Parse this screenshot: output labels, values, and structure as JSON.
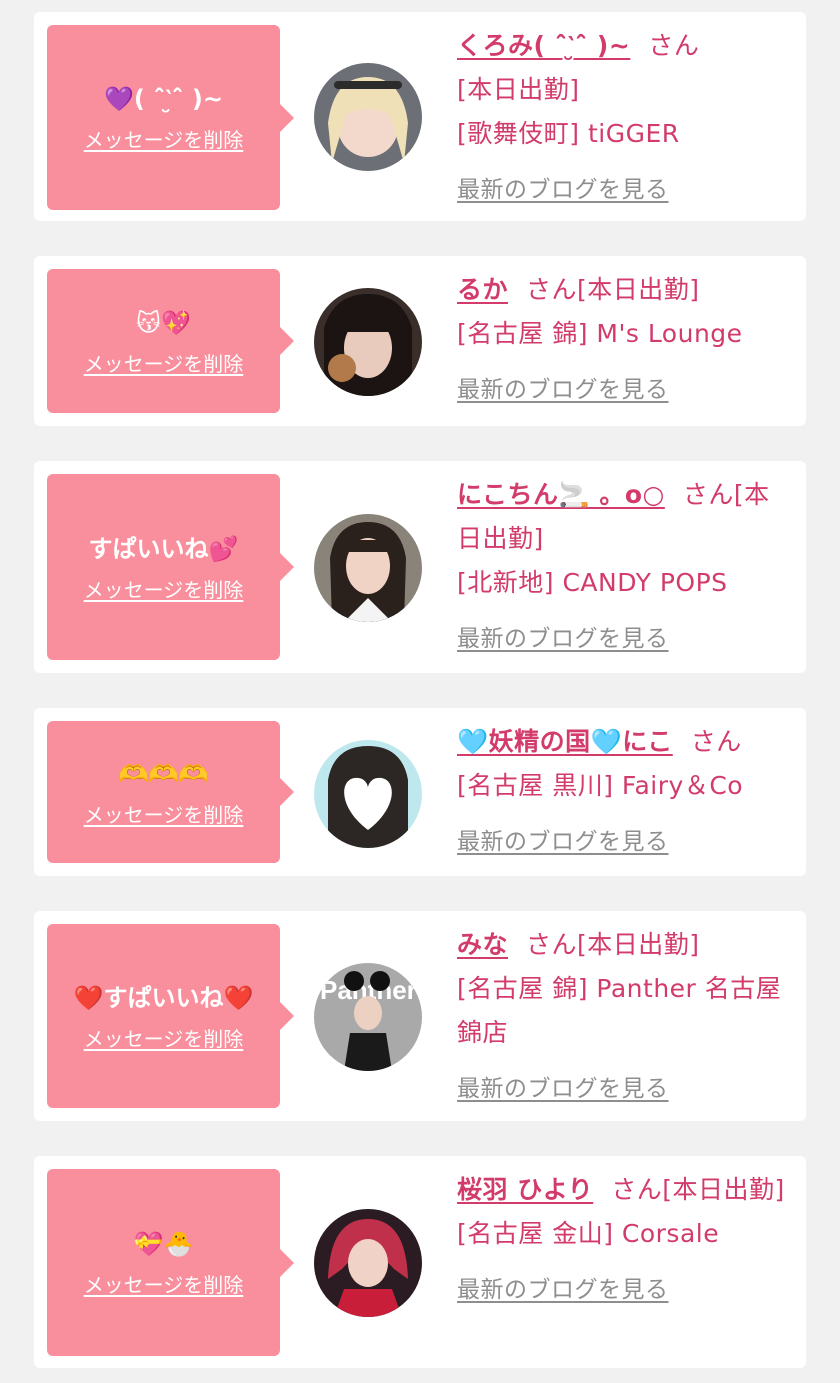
{
  "cards": [
    {
      "message": "💜( ˆ̑‵̮ˆ̑ )~",
      "delete_label": "メッセージを削除",
      "name": "くろみ( ˆ̑‵̮ˆ̑ )~",
      "san": "さん",
      "status": "[本日出勤]",
      "shop": "[歌舞伎町] tiGGER",
      "blog_label": "最新のブログを見る"
    },
    {
      "message": "😽💖",
      "delete_label": "メッセージを削除",
      "name": "るか",
      "san": "さん",
      "status": "[本日出勤]",
      "shop": "[名古屋 錦] M's Lounge",
      "blog_label": "最新のブログを見る"
    },
    {
      "message": "すぱいいね💕",
      "delete_label": "メッセージを削除",
      "name": "にこちん🚬 。o○",
      "san": "さん",
      "status": "[本日出勤]",
      "shop": "[北新地] CANDY POPS",
      "blog_label": "最新のブログを見る"
    },
    {
      "message": "🫶🫶🫶",
      "delete_label": "メッセージを削除",
      "name": "🩵妖精の国🩵にこ",
      "san": "さん",
      "status": "",
      "shop": "[名古屋 黒川] Fairy＆Co",
      "blog_label": "最新のブログを見る"
    },
    {
      "message": "❤️すぱいいね❤️",
      "delete_label": "メッセージを削除",
      "name": "みな",
      "san": "さん",
      "status": "[本日出勤]",
      "shop": "[名古屋 錦] Panther 名古屋錦店",
      "blog_label": "最新のブログを見る"
    },
    {
      "message": "💝🐣",
      "delete_label": "メッセージを削除",
      "name": "桜羽 ひより",
      "san": "さん",
      "status": "[本日出勤]",
      "shop": "[名古屋 金山] Corsale",
      "blog_label": "最新のブログを見る"
    }
  ],
  "colors": {
    "background": "#f1f1f1",
    "card": "#ffffff",
    "bubble": "#f98e9c",
    "accent": "#d23b6a",
    "link_gray": "#8e8e8e"
  }
}
